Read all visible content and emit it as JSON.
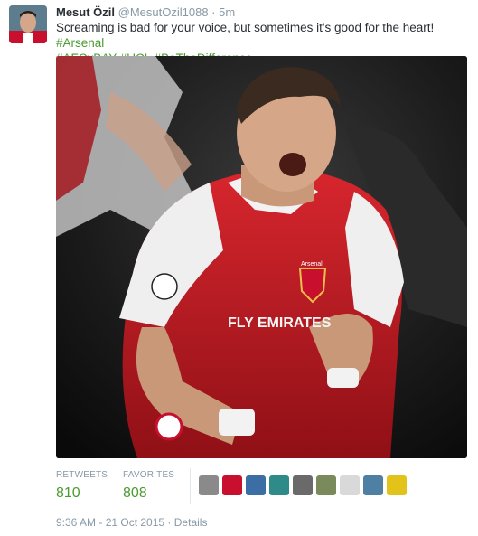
{
  "tweet": {
    "name": "Mesut Özil",
    "handle": "@MesutOzil1088",
    "separator": "·",
    "age": "5m",
    "text_plain": "Screaming is bad for your voice, but sometimes it's good for the heart!",
    "hashtags": [
      "#Arsenal",
      "#AFCvBAY",
      "#UCL",
      "#BeTheDifference"
    ],
    "photo_caption": [
      "Arsenal",
      "FLY EMIRATES"
    ]
  },
  "stats": {
    "retweets_label": "RETWEETS",
    "retweets_value": "810",
    "favorites_label": "FAVORITES",
    "favorites_value": "808"
  },
  "footer": {
    "timestamp": "9:36 AM - 21 Oct 2015",
    "separator": "·",
    "details": "Details"
  },
  "colors": {
    "hashtag": "#4a9a2f",
    "muted": "#8899a6",
    "text": "#292f33"
  }
}
